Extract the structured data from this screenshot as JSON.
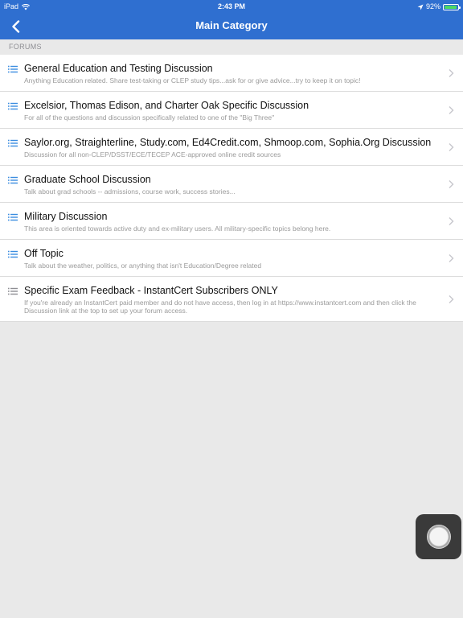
{
  "status_bar": {
    "device": "iPad",
    "time": "2:43 PM",
    "battery": "92%",
    "battery_level": 0.92
  },
  "nav": {
    "title": "Main Category",
    "back_icon": "chevron-left-icon"
  },
  "section": {
    "header": "FORUMS"
  },
  "forums": [
    {
      "title": "General Education and Testing Discussion",
      "description": "Anything Education related.  Share test-taking or CLEP study tips...ask for or give advice...try to keep it on topic!"
    },
    {
      "title": "Excelsior, Thomas Edison, and Charter Oak Specific Discussion",
      "description": "For all of the questions and discussion specifically related to one of the \"Big Three\""
    },
    {
      "title": "Saylor.org, Straighterline, Study.com, Ed4Credit.com, Shmoop.com, Sophia.Org Discussion",
      "description": "Discussion for all non-CLEP/DSST/ECE/TECEP ACE-approved online credit sources"
    },
    {
      "title": "Graduate School Discussion",
      "description": "Talk about grad schools -- admissions, course work, success stories..."
    },
    {
      "title": "Military Discussion",
      "description": "This area is oriented towards active duty and ex-military users.  All military-specific topics belong here."
    },
    {
      "title": "Off Topic",
      "description": "Talk about the weather, politics, or anything that isn't Education/Degree related"
    },
    {
      "title": "Specific Exam Feedback - InstantCert Subscribers ONLY",
      "description": "If you're already an InstantCert paid member and do not have access, then log in at https://www.instantcert.com and then click the Discussion link at the top to set up your forum access."
    }
  ],
  "colors": {
    "nav_bar": "#2f6fd0",
    "list_icon_active": "#3a8de0",
    "list_icon_inactive": "#8e8e93",
    "background": "#e9e9e9"
  }
}
